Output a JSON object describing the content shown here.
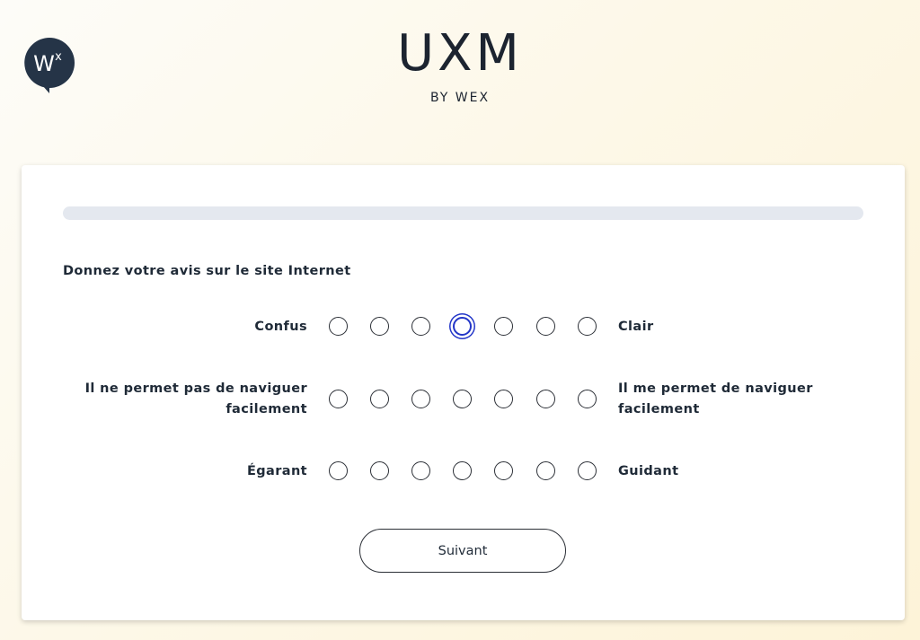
{
  "brand": {
    "logo_text": "W",
    "logo_sup": "x",
    "title": "UXM",
    "subtitle": "BY WEX"
  },
  "colors": {
    "logo_bg": "#253447",
    "focus_ring": "#2336c8",
    "progress_track": "#e4e8ef"
  },
  "progress": 0,
  "question": "Donnez votre avis sur le site Internet",
  "rows": [
    {
      "left": "Confus",
      "right": "Clair",
      "selected": null,
      "focused_index": 3
    },
    {
      "left": "Il ne permet pas de naviguer facilement",
      "right": "Il me permet de naviguer facilement",
      "selected": null,
      "focused_index": null
    },
    {
      "left": "Égarant",
      "right": "Guidant",
      "selected": null,
      "focused_index": null
    }
  ],
  "scale_points": 7,
  "next_button": "Suivant"
}
